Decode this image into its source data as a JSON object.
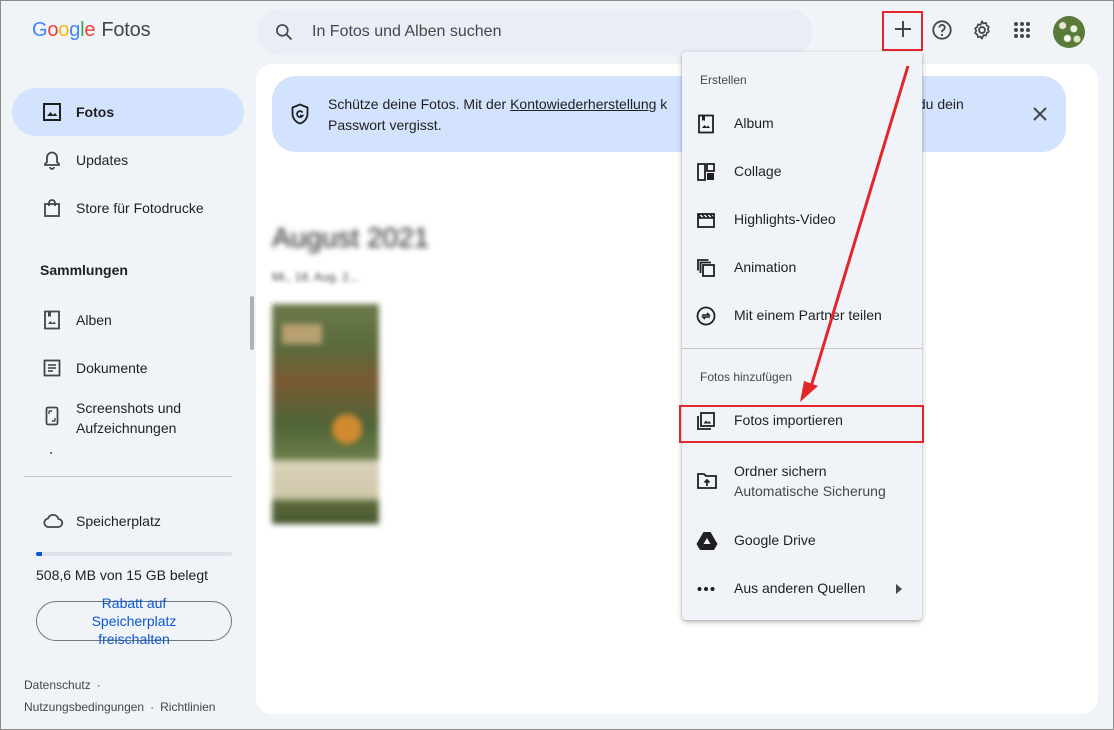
{
  "app": {
    "logo_google": [
      "G",
      "o",
      "o",
      "g",
      "l",
      "e"
    ],
    "logo_product": "Fotos"
  },
  "search": {
    "placeholder": "In Fotos und Alben suchen",
    "value": ""
  },
  "header": {
    "icons": [
      "plus-icon",
      "help-icon",
      "gear-icon",
      "apps-grid-icon",
      "avatar"
    ]
  },
  "sidebar": {
    "items": [
      {
        "label": "Fotos",
        "icon": "photo-icon",
        "active": true
      },
      {
        "label": "Updates",
        "icon": "bell-icon"
      },
      {
        "label": "Store für Fotodrucke",
        "icon": "shopping-bag-icon"
      }
    ],
    "collections_title": "Sammlungen",
    "collections": [
      {
        "label": "Alben",
        "icon": "album-icon"
      },
      {
        "label": "Dokumente",
        "icon": "document-icon"
      },
      {
        "label": "Screenshots und Aufzeichnungen",
        "icon": "phone-screenshot-icon"
      }
    ],
    "storage": {
      "label": "Speicherplatz",
      "used_text": "508,6 MB von 15 GB belegt",
      "used_fraction": 0.033,
      "button_label": "Rabatt auf Speicherplatz freischalten"
    },
    "footer": {
      "privacy": "Datenschutz",
      "terms": "Nutzungsbedingungen",
      "policies": "Richtlinien",
      "separator": "·"
    }
  },
  "banner": {
    "text_before": "Schütze deine Fotos. Mit der ",
    "link": "Kontowiederherstellung",
    "text_mid": " k",
    "text_right": "s du dein",
    "text_line2": "Passwort vergisst."
  },
  "main": {
    "date_heading": "August 2021",
    "date_sub": "Mi., 18. Aug. 2..."
  },
  "menu": {
    "create_heading": "Erstellen",
    "create_items": [
      {
        "label": "Album",
        "icon": "album-icon"
      },
      {
        "label": "Collage",
        "icon": "collage-icon"
      },
      {
        "label": "Highlights-Video",
        "icon": "movie-icon"
      },
      {
        "label": "Animation",
        "icon": "animation-icon"
      },
      {
        "label": "Mit einem Partner teilen",
        "icon": "partner-share-icon"
      }
    ],
    "add_heading": "Fotos hinzufügen",
    "import_label": "Fotos importieren",
    "backup_label": "Ordner sichern",
    "backup_sub": "Automatische Sicherung",
    "drive_label": "Google Drive",
    "other_label": "Aus anderen Quellen"
  },
  "colors": {
    "accent": "#0b57d0",
    "active_nav": "#d3e3fd",
    "annotation_red": "#e3262a"
  }
}
